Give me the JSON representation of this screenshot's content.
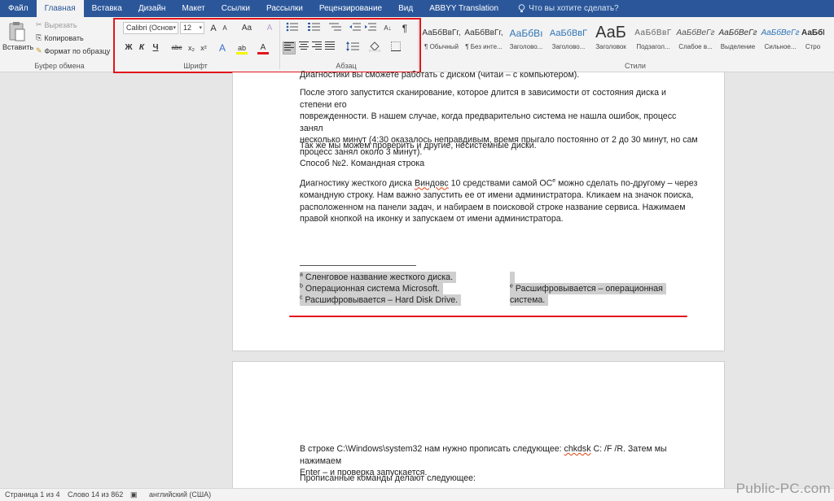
{
  "tabs": [
    {
      "label": "Файл"
    },
    {
      "label": "Главная"
    },
    {
      "label": "Вставка"
    },
    {
      "label": "Дизайн"
    },
    {
      "label": "Макет"
    },
    {
      "label": "Ссылки"
    },
    {
      "label": "Рассылки"
    },
    {
      "label": "Рецензирование"
    },
    {
      "label": "Вид"
    },
    {
      "label": "ABBYY Translation"
    }
  ],
  "tell_me_placeholder": "Что вы хотите сделать?",
  "clipboard": {
    "paste_label": "Вставить",
    "cut_label": "Вырезать",
    "copy_label": "Копировать",
    "format_painter_label": "Формат по образцу",
    "group_label": "Буфер обмена"
  },
  "font": {
    "font_name": "Calibri (Основ",
    "font_size": "12",
    "grow": "A",
    "shrink": "A",
    "case": "Aa",
    "clear": "A",
    "bold": "Ж",
    "italic": "К",
    "underline": "Ч",
    "strike": "abc",
    "subscript": "x₂",
    "superscript": "x²",
    "effects": "A",
    "highlight": "ab",
    "color": "A",
    "group_label": "Шрифт"
  },
  "paragraph": {
    "sort": "A↓",
    "show_marks": "¶",
    "group_label": "Абзац"
  },
  "styles": {
    "items": [
      {
        "sample": "АаБбВвГг,",
        "name": "¶ Обычный"
      },
      {
        "sample": "АаБбВвГг,",
        "name": "¶ Без инте..."
      },
      {
        "sample": "АаБбВı",
        "name": "Заголово..."
      },
      {
        "sample": "АаБбВвГ",
        "name": "Заголово..."
      },
      {
        "sample": "АаБ",
        "name": "Заголовок"
      },
      {
        "sample": "АаБбВвГ",
        "name": "Подзагол..."
      },
      {
        "sample": "АаБбВеГг",
        "name": "Слабое в..."
      },
      {
        "sample": "АаБбВеГг",
        "name": "Выделение"
      },
      {
        "sample": "АаБбВеГг",
        "name": "Сильное..."
      },
      {
        "sample": "АаБбВ",
        "name": "Стро"
      }
    ],
    "group_label": "Стили"
  },
  "document": {
    "top_line": "Диагностики вы сможете работать с диском (читаи – с компьютером).",
    "p1_l1": "После этого запустится сканирование, которое длится в зависимости от состояния диска и степени его",
    "p1_l2": "поврежденности. В нашем случае, когда предварительно система не нашла ошибок, процесс занял",
    "p1_l3": "несколько минут (4:30 оказалось неправдивым, время прыгало постоянно от 2 до 30 минут, но сам",
    "p1_l4": "процесс занял около 3 минут).",
    "p2": "Так же мы можем проверить и другие, несистемные диски.",
    "p3": "Способ №2. Командная строка",
    "p4_l1a": "Диагностику жесткого диска ",
    "p4_l1b": "Виндовс",
    "p4_l1c": " 10 средствами самой ОС",
    "p4_l1d": " можно сделать по-другому – через",
    "p4_l2": "командную строку. Нам важно запустить ее от имени администратора. Кликаем на значок поиска,",
    "p4_l3": "расположенном на панели задач, и набираем в поисковой строке название сервиса. Нажимаем",
    "p4_l4": "правой кнопкой на иконку и запускаем от имени администратора.",
    "fn_a_mark": "a",
    "fn_a": "Сленговое название жесткого диска.",
    "fn_b_mark": "b",
    "fn_b": "Операционная система Microsoft.",
    "fn_c_mark": "c",
    "fn_c": "Расшифровывается – Hard Disk Drive.",
    "fn_e_mark": "e",
    "fn_e_l1": "Расшифровывается – операционная",
    "fn_e_l2": "система.",
    "p5_l1a": "В строке C:\\Windows\\system32 нам нужно прописать следующее: ",
    "p5_l1b": "chkdsk",
    "p5_l1c": " C: /F /R. Затем мы нажимаем",
    "p5_l2": "Enter – и проверка запускается.",
    "p6": "Прописанные команды делают следующее:"
  },
  "status": {
    "page": "Страница 1 из 4",
    "words": "Слово 14 из 862",
    "language": "английский (США)"
  },
  "watermark": "Public-PC.com",
  "colors": {
    "tab_bar": "#2b579a",
    "annotation_red": "#e3141c"
  }
}
